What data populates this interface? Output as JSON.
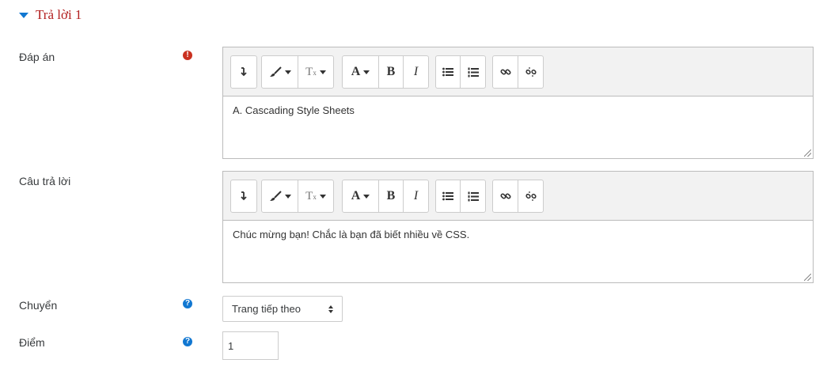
{
  "section": {
    "title": "Trả lời 1"
  },
  "answer": {
    "label": "Đáp án",
    "required_icon": "exclamation-circle-icon",
    "content": "A. Cascading Style Sheets"
  },
  "feedback": {
    "label": "Câu trả lời",
    "content": "Chúc mừng bạn! Chắc là bạn đã biết nhiều về CSS."
  },
  "jump": {
    "label": "Chuyển",
    "help_icon": "question-circle-icon",
    "selected": "Trang tiếp theo"
  },
  "score": {
    "label": "Điểm",
    "help_icon": "question-circle-icon",
    "value": "1"
  },
  "toolbar": {
    "buttons": [
      "show-more",
      "text-style",
      "clear-formatting",
      "font-color",
      "bold",
      "italic",
      "unordered-list",
      "ordered-list",
      "link",
      "unlink"
    ],
    "font_color_label": "A",
    "bold_label": "B",
    "italic_label": "I"
  },
  "colors": {
    "accent": "#1177d1",
    "title": "#b21e1e",
    "error": "#ca3120"
  }
}
